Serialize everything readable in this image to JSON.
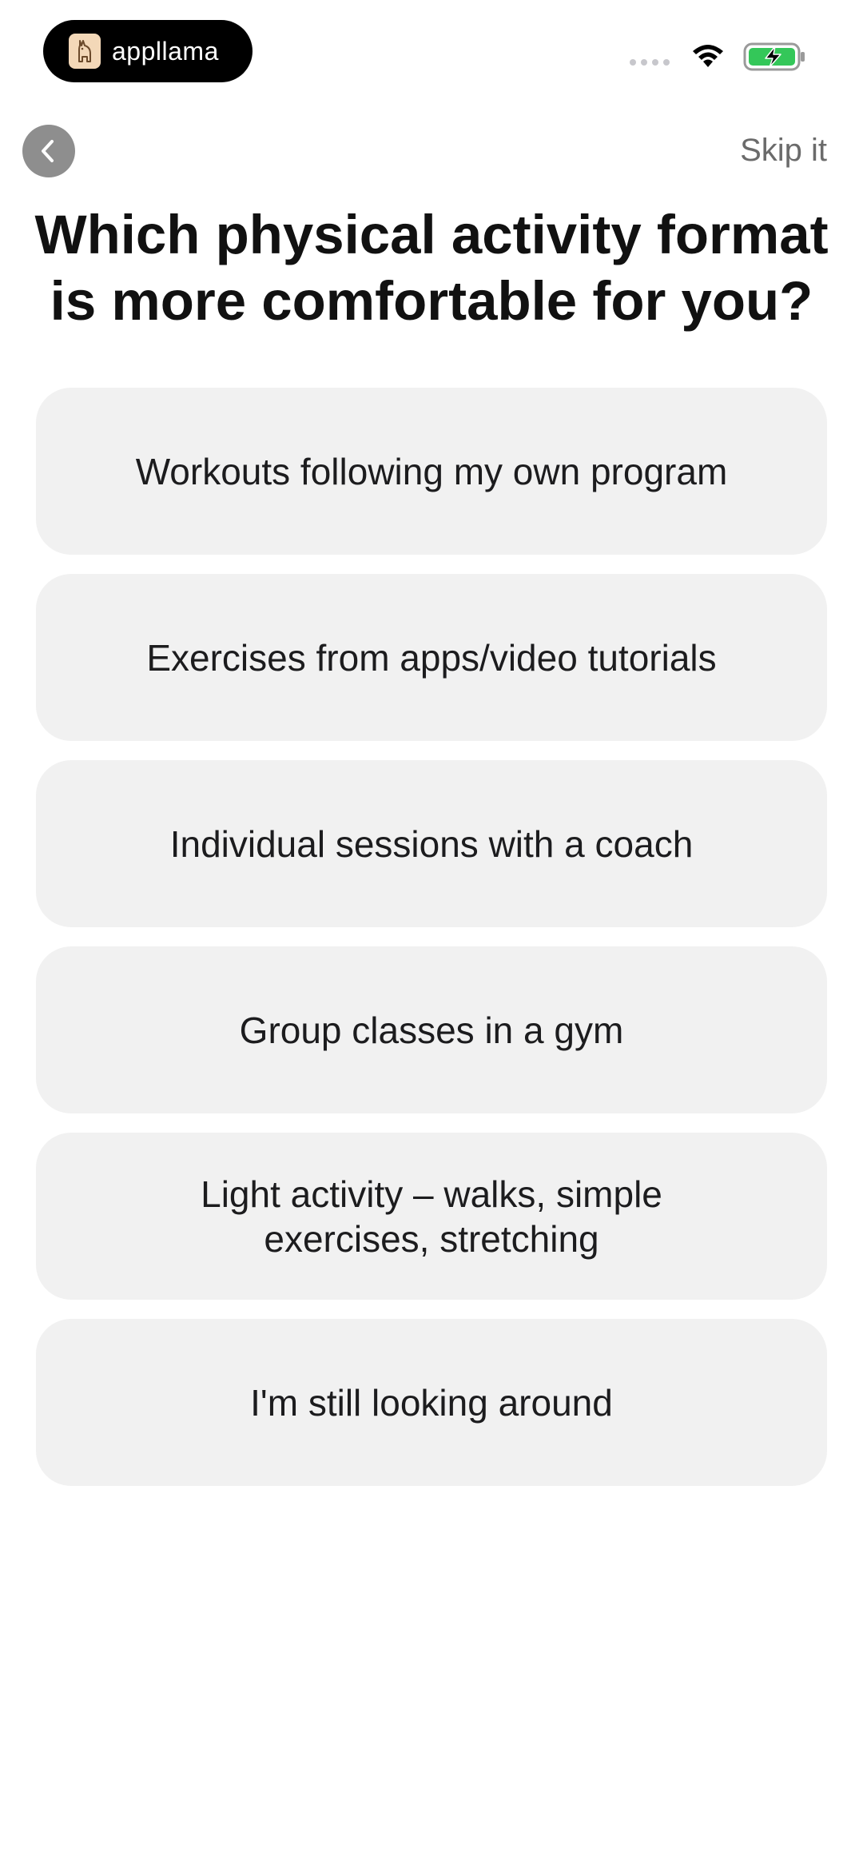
{
  "status_bar": {
    "app_badge_name": "appllama",
    "logo_icon": "llama-logo-icon",
    "wifi_icon": "wifi-icon",
    "battery_icon": "battery-charging-icon",
    "accent_battery": "#34c759"
  },
  "nav": {
    "back_icon": "chevron-left-icon",
    "skip_label": "Skip it"
  },
  "question": {
    "title": "Which physical activity format is more comfortable for you?"
  },
  "options": [
    {
      "label": "Workouts following my own program"
    },
    {
      "label": "Exercises from apps/video tutorials"
    },
    {
      "label": "Individual sessions with a coach"
    },
    {
      "label": "Group classes in a gym"
    },
    {
      "label": "Light activity – walks, simple exercises, stretching"
    },
    {
      "label": "I'm still looking around"
    }
  ],
  "colors": {
    "option_background": "#f1f1f1",
    "back_button": "#8e8e8e",
    "skip_text": "#6b6b6b"
  }
}
